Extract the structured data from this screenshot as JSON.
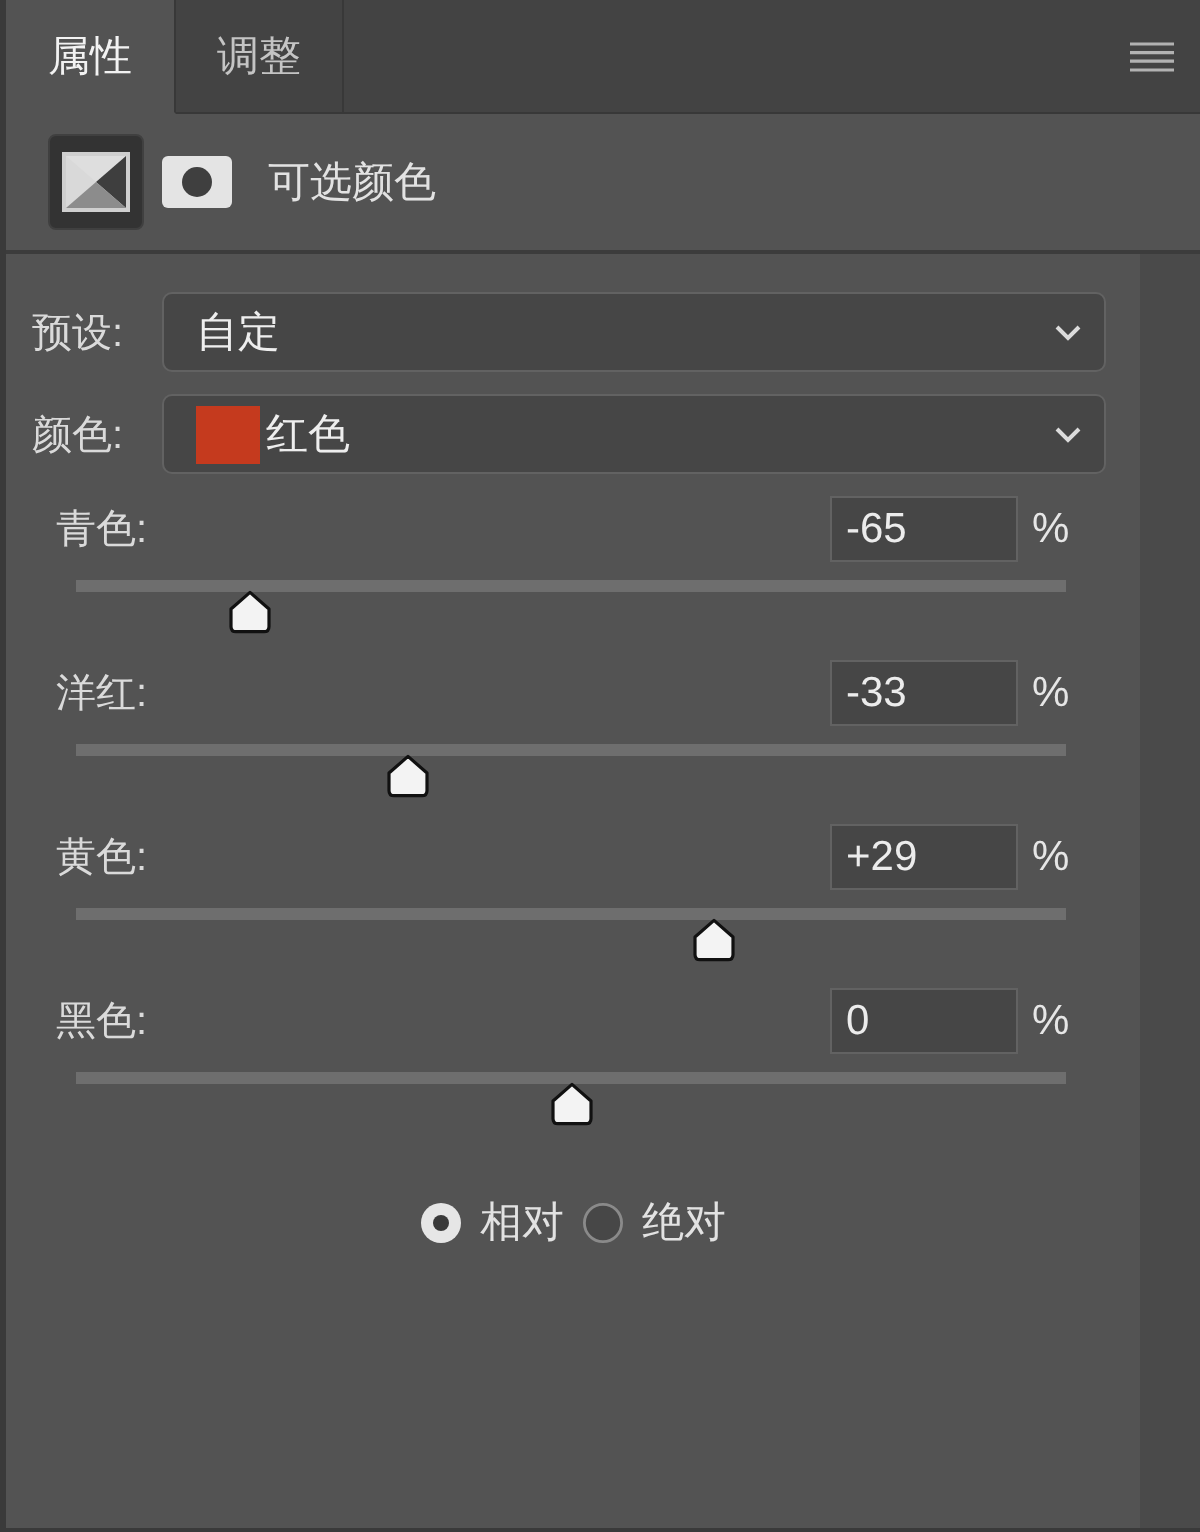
{
  "tabs": [
    {
      "label": "属性",
      "selected": true
    },
    {
      "label": "调整",
      "selected": false
    }
  ],
  "header": {
    "buttons": [
      {
        "kind": "adjustment",
        "selected": true
      },
      {
        "kind": "mask",
        "selected": false
      }
    ],
    "title": "可选颜色"
  },
  "preset": {
    "label": "预设:",
    "value": "自定"
  },
  "color": {
    "label": "颜色:",
    "value": "红色",
    "color": "#c53a1e"
  },
  "sliders": [
    {
      "label": "青色:",
      "value": "-65",
      "unit": "%",
      "level": 0.175
    },
    {
      "label": "洋红:",
      "value": "-33",
      "unit": "%",
      "level": 0.335
    },
    {
      "label": "黄色:",
      "value": "+29",
      "unit": "%",
      "level": 0.645
    },
    {
      "label": "黑色:",
      "value": "0",
      "unit": "%",
      "level": 0.5
    }
  ],
  "method": [
    {
      "label": "相对",
      "selected": true
    },
    {
      "label": "绝对",
      "selected": false
    }
  ]
}
